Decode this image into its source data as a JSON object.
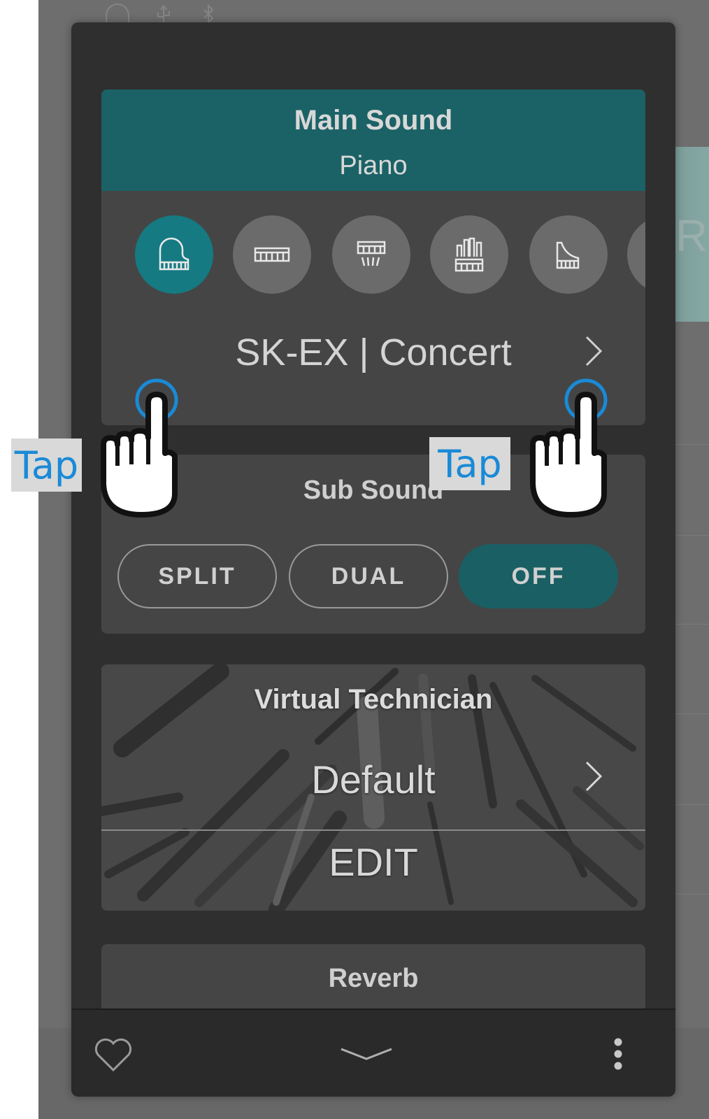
{
  "main_sound": {
    "title": "Main Sound",
    "category": "Piano",
    "categories": [
      {
        "icon": "grand-piano-icon",
        "selected": true
      },
      {
        "icon": "electric-piano-icon",
        "selected": false
      },
      {
        "icon": "harpsichord-icon",
        "selected": false
      },
      {
        "icon": "organ-icon",
        "selected": false
      },
      {
        "icon": "upright-grand-icon",
        "selected": false
      },
      {
        "icon": "partial-category-icon",
        "selected": false
      }
    ],
    "sound_name": "SK-EX | Concert"
  },
  "sub_sound": {
    "title": "Sub Sound",
    "buttons": {
      "split": "SPLIT",
      "dual": "DUAL",
      "off": "OFF"
    },
    "active": "OFF"
  },
  "virtual_technician": {
    "title": "Virtual Technician",
    "value": "Default",
    "edit_label": "EDIT"
  },
  "reverb": {
    "title": "Reverb"
  },
  "annotations": {
    "tap_left": "Tap",
    "tap_right": "Tap"
  },
  "background": {
    "right_letter": "R"
  },
  "colors": {
    "accent_teal": "#157a82",
    "header_teal": "#1b6266",
    "panel": "#2f2f2f",
    "card": "#454545",
    "tap_blue": "#1a8ad6"
  }
}
